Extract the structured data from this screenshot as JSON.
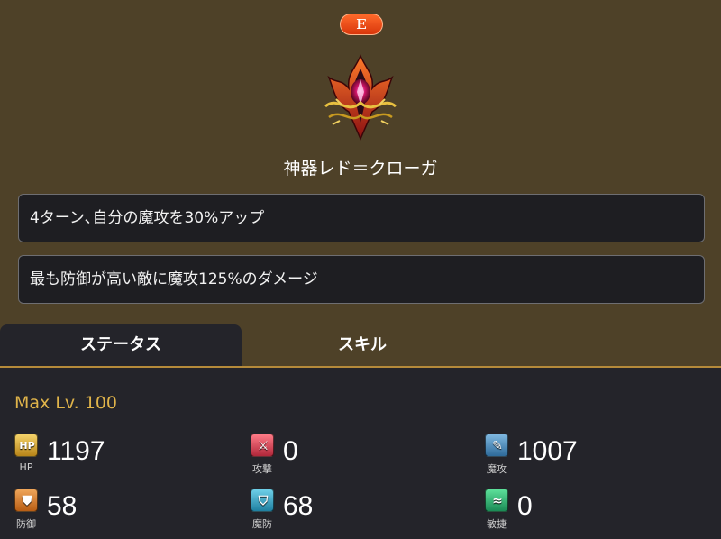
{
  "artifact": {
    "grade": "E",
    "name": "神器レド＝クローガ",
    "icon": "crimson-flame-crest-icon",
    "effects": [
      "4ターン､自分の魔攻を30%アップ",
      "最も防御が高い敵に魔攻125%のダメージ"
    ]
  },
  "tabs": {
    "status": "ステータス",
    "skill": "スキル",
    "active": "status"
  },
  "panel": {
    "max_level": "Max Lv. 100",
    "stats": {
      "hp": {
        "label": "HP",
        "value": "1197",
        "icon": "hp-icon"
      },
      "attack": {
        "label": "攻撃",
        "value": "0",
        "icon": "sword-icon"
      },
      "magic_attack": {
        "label": "魔攻",
        "value": "1007",
        "icon": "wand-icon"
      },
      "defense": {
        "label": "防御",
        "value": "58",
        "icon": "shield-icon"
      },
      "magic_defense": {
        "label": "魔防",
        "value": "68",
        "icon": "magic-shield-icon"
      },
      "agility": {
        "label": "敏捷",
        "value": "0",
        "icon": "wind-icon"
      }
    }
  },
  "colors": {
    "background": "#4e4128",
    "panel": "#24242a",
    "accent_gold": "#e0b44a",
    "grade_badge": "#e8481a"
  }
}
